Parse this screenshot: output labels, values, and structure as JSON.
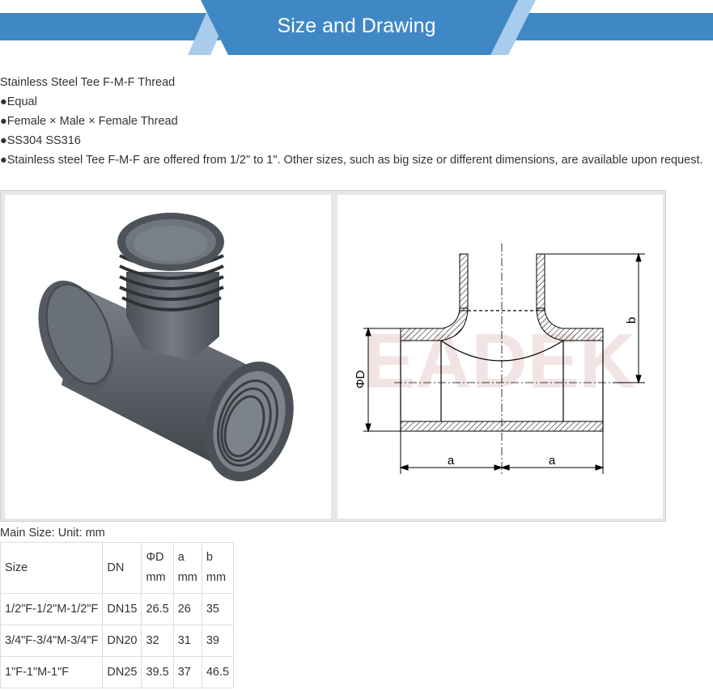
{
  "banner": {
    "title": "Size and Drawing"
  },
  "intro": {
    "lines": [
      "Stainless Steel Tee F-M-F Thread",
      "●Equal",
      "●Female × Male × Female Thread",
      "●SS304 SS316",
      "●Stainless steel Tee F-M-F are offered from 1/2\" to 1\". Other sizes, such as big size or different dimensions, are available upon request."
    ]
  },
  "drawing": {
    "label_b": "b",
    "label_d": "ΦD",
    "label_a_left": "a",
    "label_a_right": "a",
    "watermark": "EADEK"
  },
  "size_caption": "Main Size:   Unit:  mm",
  "table": {
    "headers": {
      "size": "Size",
      "dn": "DN",
      "d_line1": "ΦD",
      "d_line2": "mm",
      "a_line1": "a",
      "a_line2": "mm",
      "b_line1": "b",
      "b_line2": "mm"
    },
    "rows": [
      {
        "size": "1/2\"F-1/2\"M-1/2\"F",
        "dn": "DN15",
        "d": "26.5",
        "a": "26",
        "b": "35"
      },
      {
        "size": "3/4\"F-3/4\"M-3/4\"F",
        "dn": "DN20",
        "d": "32",
        "a": "31",
        "b": "39"
      },
      {
        "size": "1\"F-1\"M-1\"F",
        "dn": "DN25",
        "d": "39.5",
        "a": "37",
        "b": "46.5"
      }
    ]
  },
  "colors": {
    "banner_blue": "#3f88c5",
    "banner_light": "#a9cbec",
    "pipe_gray": "#5f656c",
    "line_black": "#000000"
  }
}
